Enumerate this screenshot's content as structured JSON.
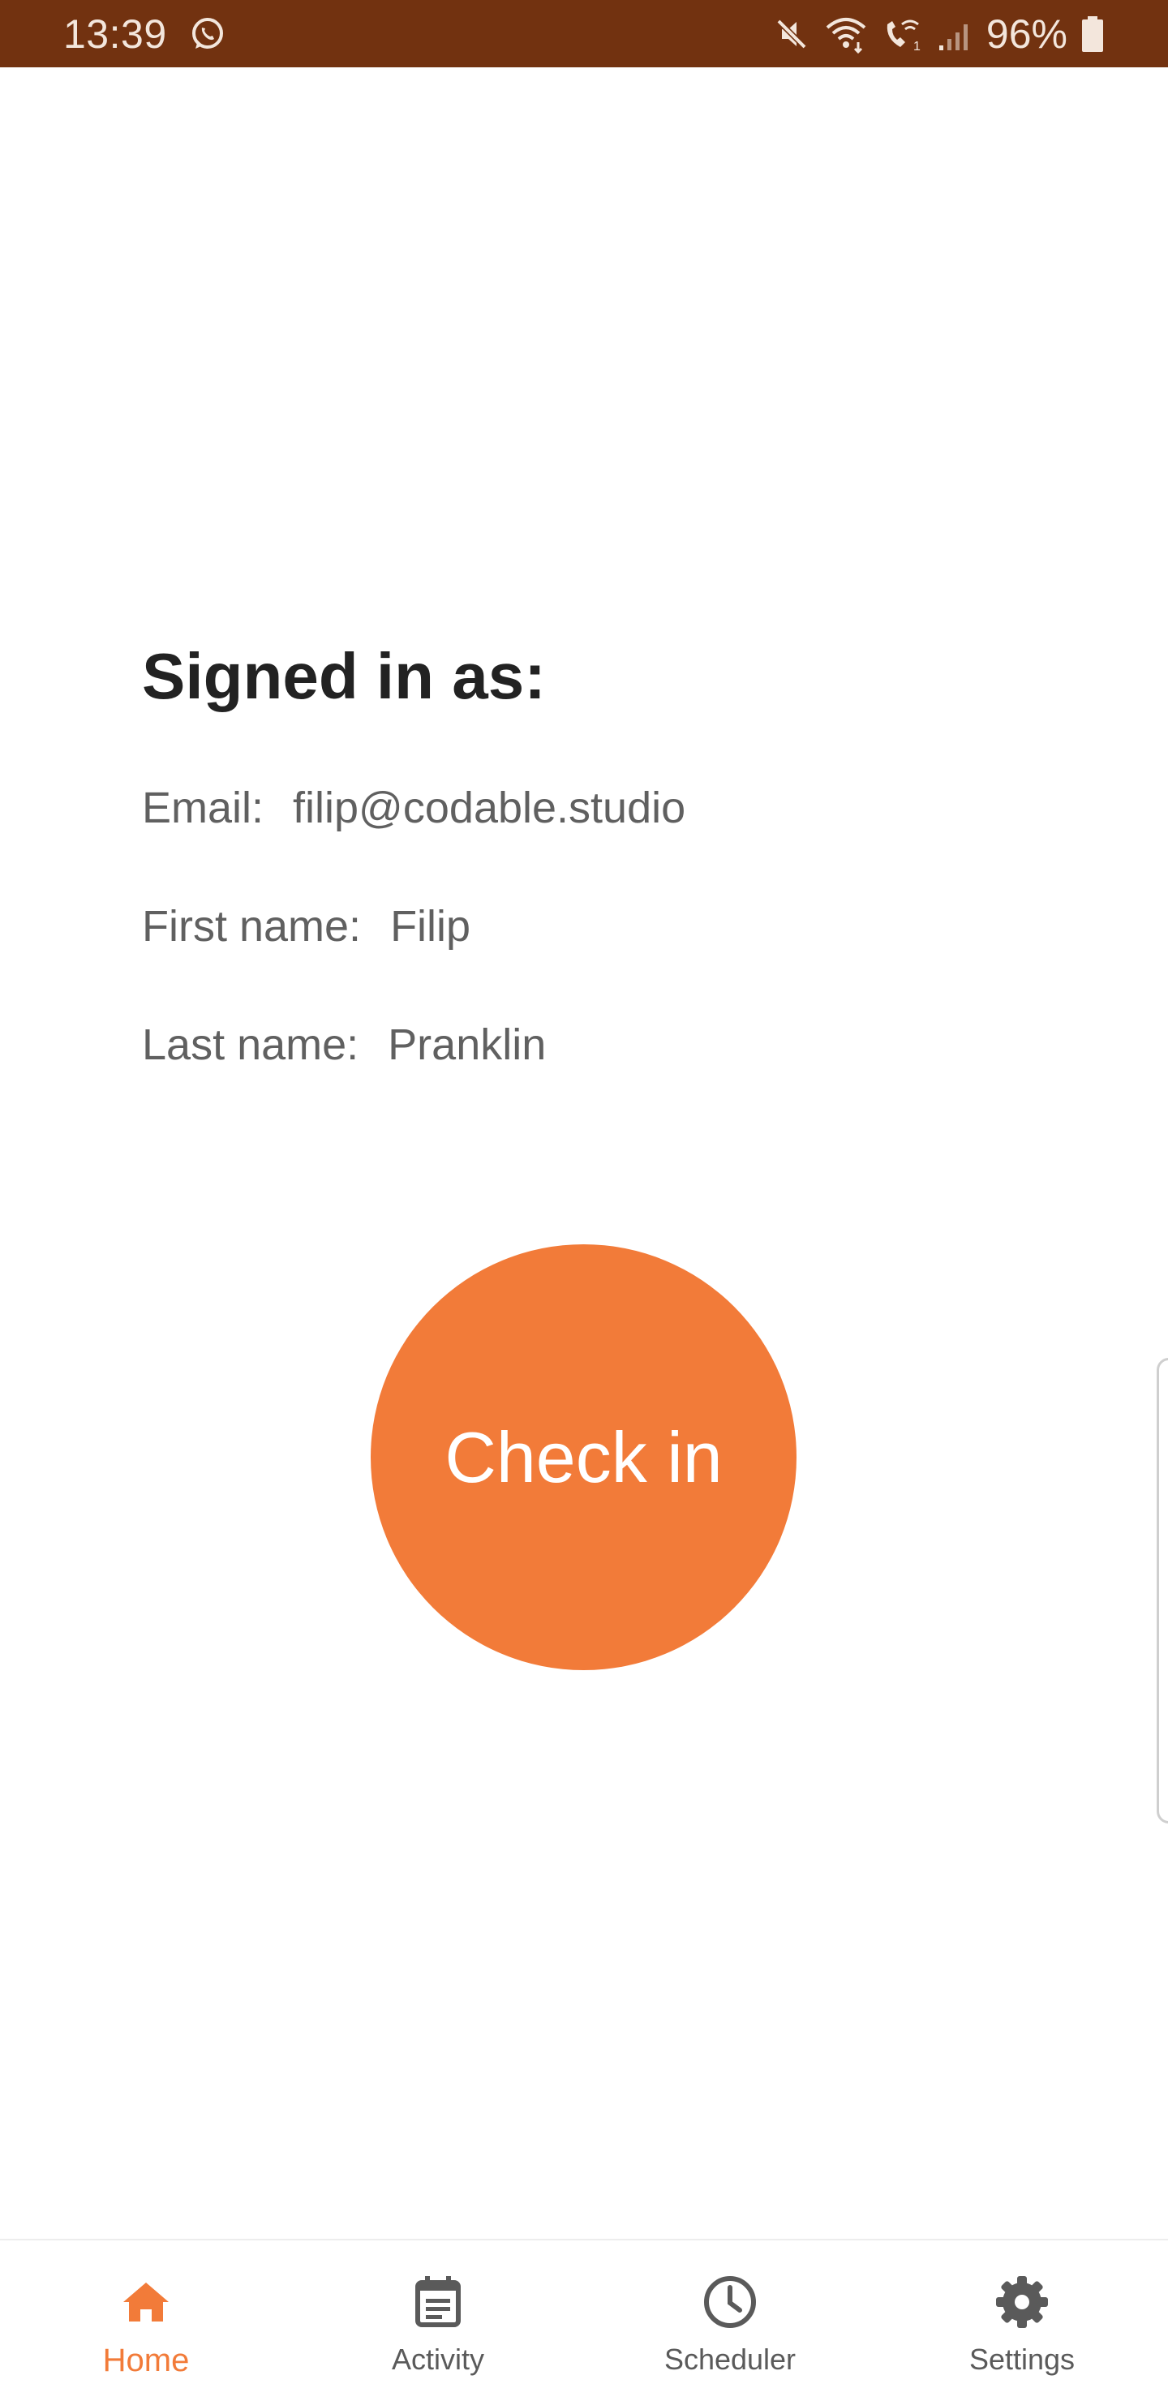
{
  "status_bar": {
    "time": "13:39",
    "battery_percent": "96%",
    "icons": [
      "whatsapp-icon",
      "mute-icon",
      "wifi-icon",
      "wifi-calling-icon",
      "signal-icon",
      "battery-icon"
    ]
  },
  "profile": {
    "title": "Signed in as:",
    "email_label": "Email:",
    "email_value": "filip@codable.studio",
    "first_name_label": "First name:",
    "first_name_value": "Filip",
    "last_name_label": "Last name:",
    "last_name_value": "Pranklin"
  },
  "checkin_button": {
    "label": "Check in"
  },
  "bottom_nav": {
    "items": [
      {
        "label": "Home",
        "icon": "home-icon",
        "active": true
      },
      {
        "label": "Activity",
        "icon": "activity-icon",
        "active": false
      },
      {
        "label": "Scheduler",
        "icon": "clock-icon",
        "active": false
      },
      {
        "label": "Settings",
        "icon": "gear-icon",
        "active": false
      }
    ]
  },
  "colors": {
    "status_bar": "#723210",
    "accent": "#f27b39",
    "title_text": "#222222",
    "body_text": "#606060",
    "nav_inactive": "#5a5a5a"
  }
}
